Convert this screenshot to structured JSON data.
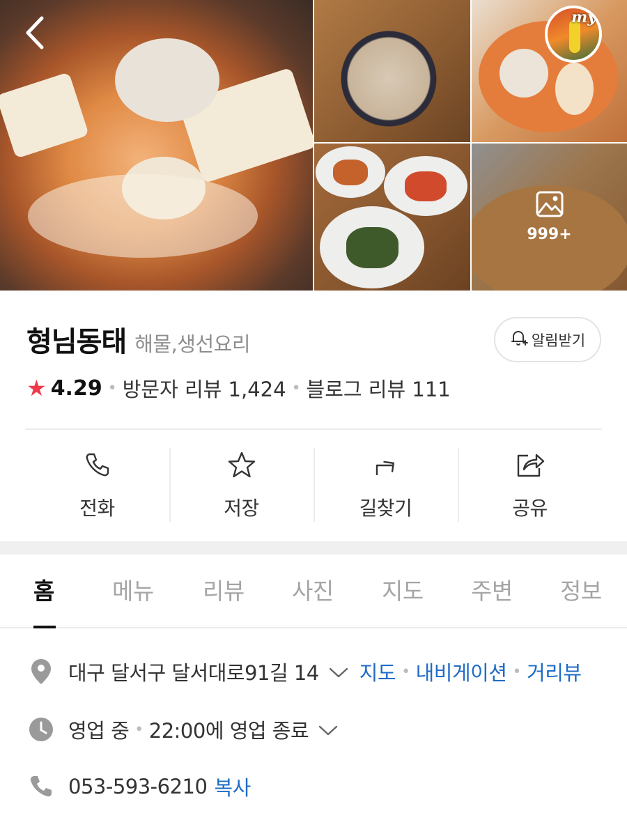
{
  "place": {
    "name": "형님동태",
    "category": "해물,생선요리",
    "notify_label": "알림받기"
  },
  "gallery": {
    "more_count": "999+",
    "avatar_mark": "my"
  },
  "rating": {
    "score": "4.29",
    "visitor_reviews": "방문자 리뷰 1,424",
    "blog_reviews": "블로그 리뷰 111"
  },
  "actions": [
    {
      "label": "전화",
      "icon": "phone-icon"
    },
    {
      "label": "저장",
      "icon": "star-icon"
    },
    {
      "label": "길찾기",
      "icon": "directions-icon"
    },
    {
      "label": "공유",
      "icon": "share-icon"
    }
  ],
  "tabs": [
    {
      "label": "홈",
      "active": true
    },
    {
      "label": "메뉴"
    },
    {
      "label": "리뷰"
    },
    {
      "label": "사진"
    },
    {
      "label": "지도"
    },
    {
      "label": "주변"
    },
    {
      "label": "정보"
    }
  ],
  "info": {
    "address": "대구 달서구 달서대로91길 14",
    "address_links": [
      "지도",
      "내비게이션",
      "거리뷰"
    ],
    "status": "영업 중",
    "hours": "22:00에 영업 종료",
    "phone": "053-593-6210",
    "copy_label": "복사"
  },
  "colors": {
    "star": "#f0394a",
    "link": "#1f6cc6",
    "icon_gray": "#9a9a9a"
  }
}
